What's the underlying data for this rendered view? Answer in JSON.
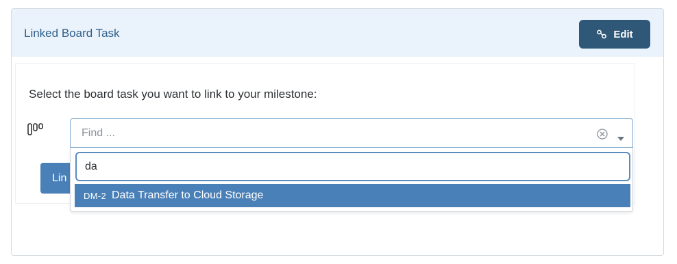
{
  "panel": {
    "title": "Linked Board Task",
    "edit_button": {
      "label": "Edit",
      "icon": "link-icon"
    }
  },
  "form": {
    "prompt": "Select the board task you want to link to your milestone:",
    "board_icon": "board-columns-icon",
    "select": {
      "placeholder": "Find ...",
      "clear_icon": "clear-circle-icon",
      "caret_icon": "chevron-down-icon"
    },
    "link_button_label": "Lin"
  },
  "dropdown": {
    "search_value": "da",
    "options": [
      {
        "key": "DM-2",
        "label": "Data Transfer to Cloud Storage",
        "highlighted": true
      }
    ]
  },
  "colors": {
    "header_bg": "#eaf2fb",
    "title_text": "#2f5f8a",
    "edit_button_bg": "#2f5878",
    "highlight": "#4a80b8",
    "focus_border": "#5b8bbf"
  }
}
